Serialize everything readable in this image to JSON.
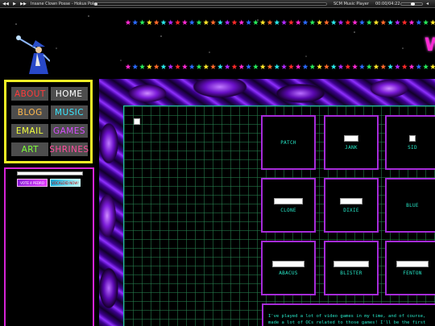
{
  "player": {
    "track_title": "Insane Clown Posse - Hokus Pokus",
    "name": "SCM Music Player",
    "time": "00:00/04:22",
    "progress": 0.0
  },
  "header": {
    "logo_text": "W"
  },
  "nav": [
    {
      "label": "ABOUT",
      "color": "#ff3b3b"
    },
    {
      "label": "HOME",
      "color": "#ffffff"
    },
    {
      "label": "BLOG",
      "color": "#ffb84d"
    },
    {
      "label": "MUSIC",
      "color": "#39e6ff"
    },
    {
      "label": "EMAIL",
      "color": "#f2ff3b"
    },
    {
      "label": "GAMES",
      "color": "#d84dff"
    },
    {
      "label": "ART",
      "color": "#7dff39"
    },
    {
      "label": "SHRINES",
      "color": "#ff4d9e"
    }
  ],
  "sidebar": {
    "badges": [
      "VOTE 4 PEDRO",
      "VOCALOID NOW!"
    ]
  },
  "cards": [
    {
      "label": "PATCH"
    },
    {
      "label": "JANK"
    },
    {
      "label": "SID"
    },
    {
      "label": "CLONE"
    },
    {
      "label": "DIXIE"
    },
    {
      "label": "BLUE"
    },
    {
      "label": "ABACUS"
    },
    {
      "label": "BLISTER"
    },
    {
      "label": "FENTON"
    }
  ],
  "intro": {
    "line1": "I've played a lot of video games in my time, and of course,",
    "line2": "made a lot of OCs related to those games! I'll be the first"
  },
  "colors": {
    "nav_border": "#f2f226",
    "sidebar_border": "#d624d6",
    "card_border": "#a62bd9",
    "card_text": "#27e8c8",
    "grid_border": "#1fbfa5"
  }
}
